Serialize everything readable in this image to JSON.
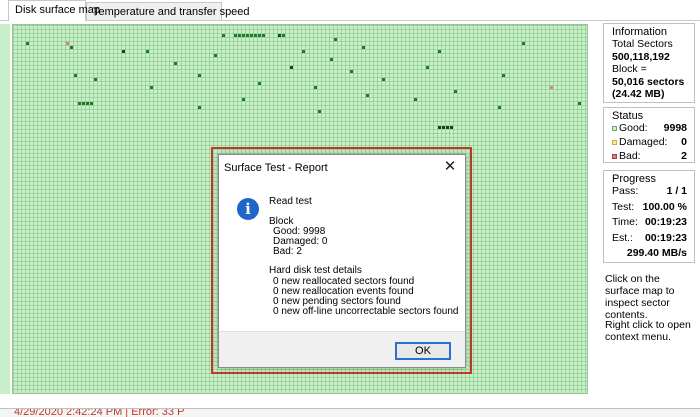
{
  "tabs": [
    {
      "label": "Disk surface map",
      "active": true
    },
    {
      "label": "Temperature and transfer speed",
      "active": false
    }
  ],
  "information": {
    "title": "Information",
    "total_sectors_label": "Total Sectors",
    "total_sectors_value": "500,118,192",
    "block_label": "Block =",
    "block_value": "50,016 sectors",
    "block_size": "(24.42 MB)"
  },
  "status": {
    "title": "Status",
    "good_label": "Good:",
    "good_value": "9998",
    "damaged_label": "Damaged:",
    "damaged_value": "0",
    "bad_label": "Bad:",
    "bad_value": "2"
  },
  "progress": {
    "title": "Progress",
    "pass_label": "Pass:",
    "pass_value": "1 / 1",
    "test_label": "Test:",
    "test_value": "100.00 %",
    "time_label": "Time:",
    "time_value": "00:19:23",
    "est_label": "Est.:",
    "est_value": "00:19:23",
    "speed": "299.40 MB/s"
  },
  "help": {
    "line1": "Click on the surface map to inspect sector contents.",
    "line2": "Right click to open context menu."
  },
  "statusbar": {
    "text": "4/29/2020 2:42:24 PM | Error: 33 P"
  },
  "dialog": {
    "title": "Surface Test - Report",
    "close_glyph": "✕",
    "icon_glyph": "i",
    "heading": "Read test",
    "block_heading": "Block",
    "good": "Good: 9998",
    "damaged": "Damaged: 0",
    "bad": "Bad: 2",
    "details_heading": "Hard disk test details",
    "detail1": "0 new reallocated sectors found",
    "detail2": "0 new reallocation events found",
    "detail3": "0 new pending sectors found",
    "detail4": "0 new off-line uncorrectable sectors found",
    "ok_label": "OK"
  },
  "colors": {
    "block_good": "#c8f0c8",
    "block_read": "#1e7a2e",
    "block_dark": "#0e4a18",
    "block_bad": "#d98080",
    "accent": "#2b6fd1",
    "highlight": "#c0392b"
  }
}
